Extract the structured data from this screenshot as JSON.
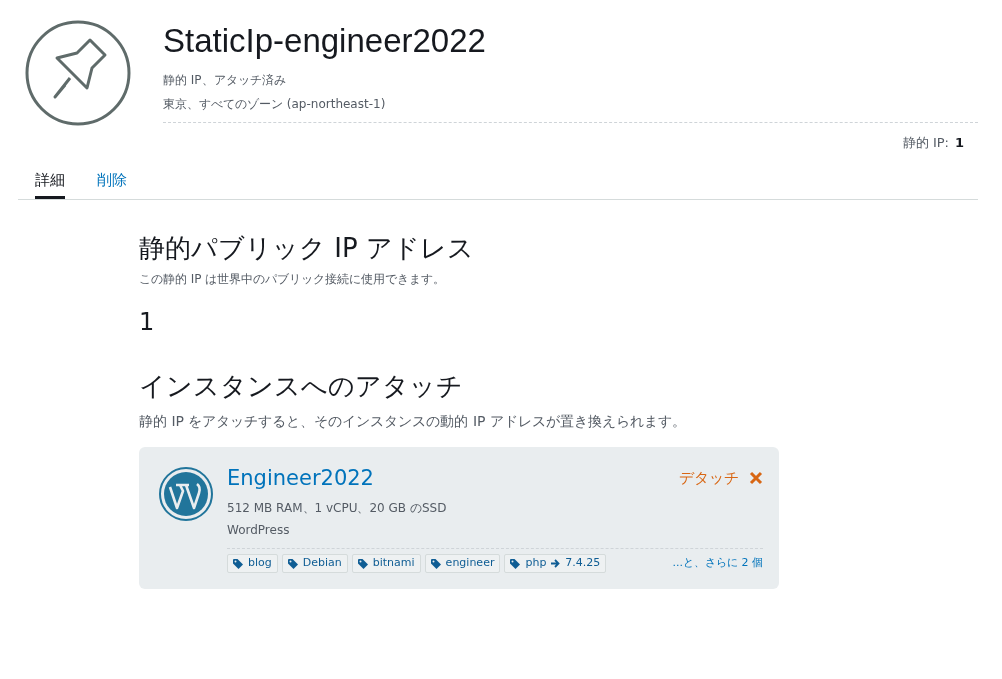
{
  "header": {
    "title": "StaticIp-engineer2022",
    "status": "静的 IP、アタッチ済み",
    "location": "東京、すべてのゾーン (ap-northeast-1)",
    "count_label": "静的 IP:",
    "count_value": "1"
  },
  "tabs": [
    {
      "label": "詳細",
      "selected": true
    },
    {
      "label": "削除",
      "selected": false
    }
  ],
  "public_ip": {
    "heading": "静的パブリック IP アドレス",
    "description": "この静的 IP は世界中のパブリック接続に使用できます。",
    "value": "1"
  },
  "attach": {
    "heading": "インスタンスへのアタッチ",
    "description": "静的 IP をアタッチすると、そのインスタンスの動的 IP アドレスが置き換えられます。",
    "instance": {
      "name": "Engineer2022",
      "specs": "512 MB RAM、1 vCPU、20 GB のSSD",
      "blueprint": "WordPress",
      "detach_label": "デタッチ",
      "tags": [
        {
          "key": "blog"
        },
        {
          "key": "Debian"
        },
        {
          "key": "bitnami"
        },
        {
          "key": "engineer"
        },
        {
          "key": "php",
          "value": "7.4.25"
        }
      ],
      "more_tags": "...と、さらに 2 個"
    }
  }
}
